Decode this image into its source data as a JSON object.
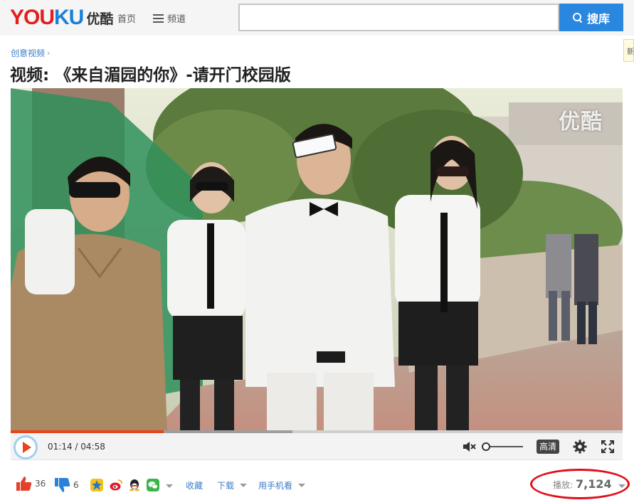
{
  "header": {
    "logo_en_you": "YOU",
    "logo_en_ku": "KU",
    "logo_cn": "优酷",
    "nav_home": "首页",
    "nav_channels": "频道",
    "search_placeholder": "",
    "search_button": "搜库",
    "side_tab": "新"
  },
  "breadcrumb": {
    "category": "创意视频",
    "arrow": "›"
  },
  "video": {
    "title": "视频: 《来自湄园的你》-请开门校园版",
    "watermark": "优酷",
    "current_time": "01:14",
    "duration": "04:58",
    "time_separator": " / ",
    "progress_fraction": 0.25,
    "buffered_fraction": 0.46,
    "volume_level": 0,
    "quality_label": "高清"
  },
  "actions": {
    "like_count": "36",
    "dislike_count": "6",
    "favorite": "收藏",
    "download": "下载",
    "watch_on_phone": "用手机看",
    "plays_label": "播放:",
    "plays_value": "7,124"
  },
  "icons": {
    "search": "search-icon",
    "menu": "menu-icon",
    "like": "thumbs-up-icon",
    "dislike": "thumbs-down-icon",
    "qzone": "qzone-star-icon",
    "weibo": "weibo-icon",
    "qq": "qq-penguin-icon",
    "wechat": "wechat-icon"
  },
  "colors": {
    "brand_red": "#e1201e",
    "brand_blue": "#1a80d9",
    "search_button": "#2a87e0",
    "progress": "#e8431b",
    "highlight_circle": "#e0101a"
  }
}
